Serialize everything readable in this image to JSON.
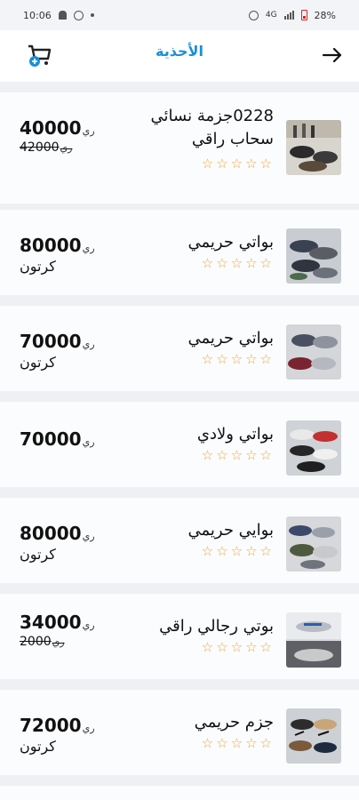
{
  "status": {
    "time": "10:06",
    "network": "4G",
    "battery": "28%"
  },
  "header": {
    "title": "الأحذية",
    "back_icon": "arrow-right-icon",
    "cart_icon": "cart-icon",
    "accent": "#1a8fd6"
  },
  "currency": "ري",
  "products": [
    {
      "name": "0228جزمة نسائي سحاب راقي",
      "price": "40000",
      "old_price": "42000",
      "unit": ""
    },
    {
      "name": "بواتي حريمي",
      "price": "80000",
      "old_price": "",
      "unit": "كرتون"
    },
    {
      "name": "بواتي حريمي",
      "price": "70000",
      "old_price": "",
      "unit": "كرتون"
    },
    {
      "name": "بواتي ولادي",
      "price": "70000",
      "old_price": "",
      "unit": ""
    },
    {
      "name": "بوايي حريمي",
      "price": "80000",
      "old_price": "",
      "unit": "كرتون"
    },
    {
      "name": "بوتي رجالي راقي",
      "price": "34000",
      "old_price": "2000",
      "unit": ""
    },
    {
      "name": "جزم حريمي",
      "price": "72000",
      "old_price": "",
      "unit": "كرتون"
    }
  ]
}
